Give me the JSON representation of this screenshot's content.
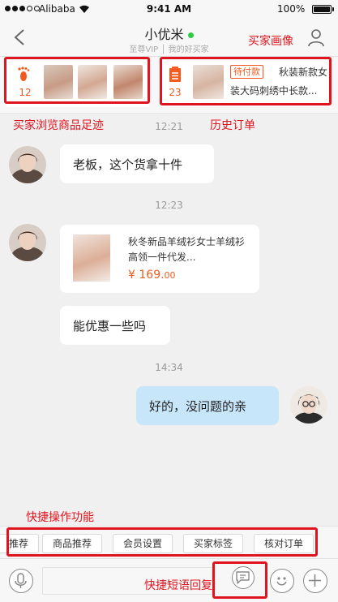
{
  "status_bar": {
    "carrier": "Alibaba",
    "time": "9:41 AM",
    "battery": "100%"
  },
  "nav": {
    "title": "小优米",
    "subtitle": "至尊VIP │ 我的好买家"
  },
  "footprint": {
    "count": "12"
  },
  "order": {
    "count": "23",
    "status": "待付款",
    "title_line1": "秋装新款女",
    "title_line2": "装大码刺绣中长款..."
  },
  "chat": {
    "messages": [
      {
        "time": "12:21",
        "text": "老板，这个货拿十件"
      },
      {
        "time": "12:23",
        "product_title": "秋冬新品羊绒衫女士羊绒衫高领一件代发...",
        "price_symbol": "¥",
        "price_int": "169.",
        "price_dec": "00"
      },
      {
        "text": "能优惠一些吗"
      },
      {
        "time": "14:34",
        "text": "好的，没问题的亲"
      }
    ]
  },
  "quick_actions": [
    "推荐",
    "商品推荐",
    "会员设置",
    "买家标签",
    "核对订单"
  ],
  "annotations": {
    "footprint": "买家浏览商品足迹",
    "orders": "历史订单",
    "profile": "买家画像",
    "quick_actions": "快捷操作功能",
    "quick_reply": "快捷短语回复"
  },
  "colors": {
    "accent": "#f25a1f",
    "annotation": "#e0141e",
    "my_bubble": "#c8e6fa",
    "online": "#2ecc40"
  }
}
